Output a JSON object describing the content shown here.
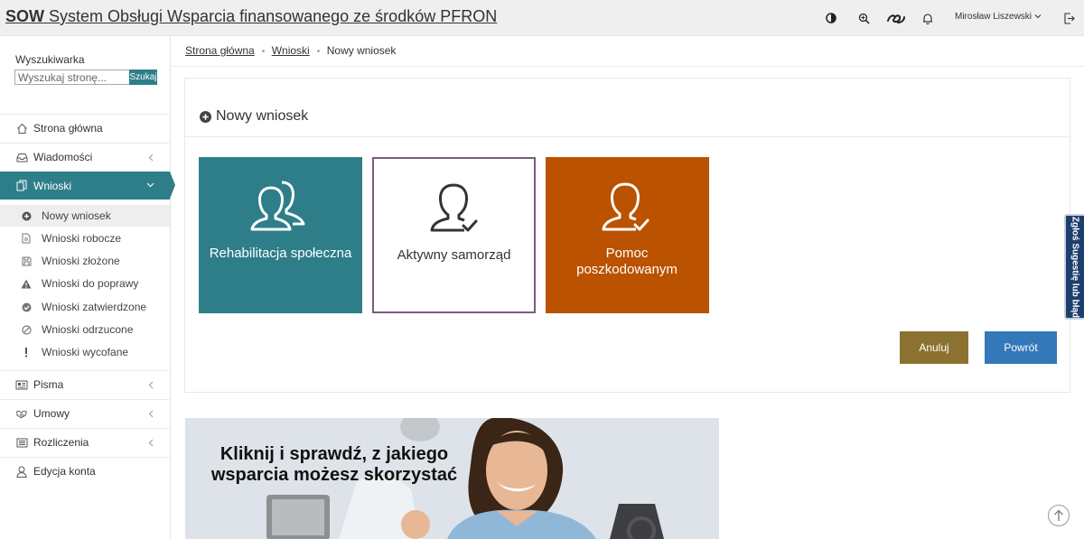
{
  "header": {
    "brand": "SOW",
    "title": "System Obsługi Wsparcia finansowanego ze środków PFRON",
    "icons": [
      "contrast-icon",
      "zoom-icon",
      "sign-language-icon",
      "bell-icon"
    ],
    "user_name": "Mirosław Liszewski"
  },
  "sidebar": {
    "search_label": "Wyszukiwarka",
    "search_placeholder": "Wyszukaj stronę...",
    "search_button": "Szukaj",
    "items": [
      {
        "label": "Strona główna",
        "icon": "home-icon"
      },
      {
        "label": "Wiadomości",
        "icon": "inbox-icon"
      },
      {
        "label": "Wnioski",
        "icon": "documents-icon"
      },
      {
        "label": "Pisma",
        "icon": "newspaper-icon"
      },
      {
        "label": "Umowy",
        "icon": "handshake-icon"
      },
      {
        "label": "Rozliczenia",
        "icon": "list-icon"
      },
      {
        "label": "Edycja konta",
        "icon": "user-icon"
      }
    ],
    "subitems": [
      {
        "label": "Nowy wniosek",
        "icon": "plus-circle-icon"
      },
      {
        "label": "Wnioski robocze",
        "icon": "file-icon"
      },
      {
        "label": "Wnioski złożone",
        "icon": "save-icon"
      },
      {
        "label": "Wnioski do poprawy",
        "icon": "warning-icon"
      },
      {
        "label": "Wnioski zatwierdzone",
        "icon": "check-circle-icon"
      },
      {
        "label": "Wnioski odrzucone",
        "icon": "ban-icon"
      },
      {
        "label": "Wnioski wycofane",
        "icon": "exclamation-icon"
      }
    ]
  },
  "breadcrumb": {
    "home": "Strona główna",
    "section": "Wnioski",
    "current": "Nowy wniosek"
  },
  "panel": {
    "title": "Nowy wniosek",
    "tiles": [
      {
        "label": "Rehabilitacja społeczna",
        "color": "#2e7e8a"
      },
      {
        "label": "Aktywny samorząd",
        "color": "#ffffff"
      },
      {
        "label": "Pomoc poszkodowanym",
        "color": "#ba5200"
      }
    ],
    "cancel_label": "Anuluj",
    "back_label": "Powrót"
  },
  "banner": {
    "line1": "Kliknij i sprawdź, z jakiego",
    "line2": "wsparcia możesz skorzystać"
  },
  "feedback_tab": "Zgłoś Sugestię lub błąd",
  "colors": {
    "accent": "#2e7e8a",
    "orange": "#ba5200",
    "tile_border": "#7b5c7d",
    "cancel": "#8b7230",
    "primary": "#3378b8"
  }
}
